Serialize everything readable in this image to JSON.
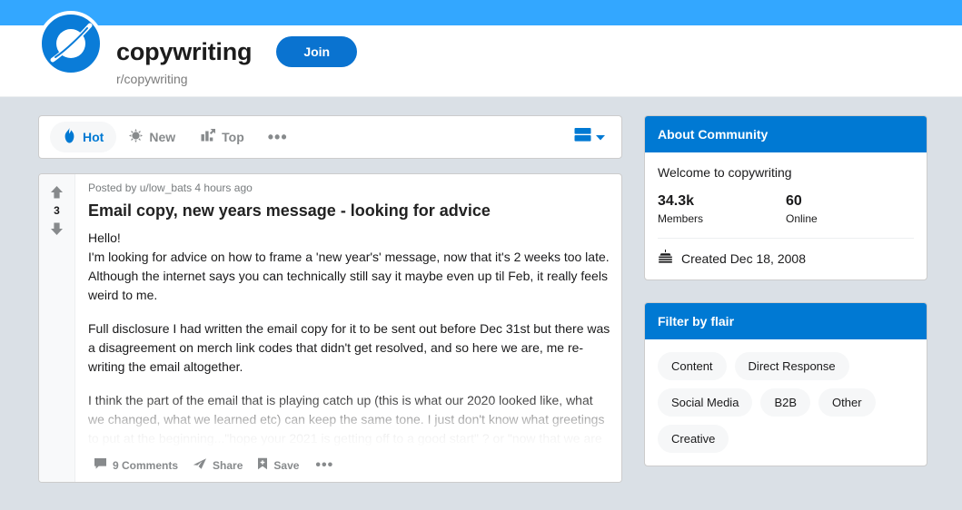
{
  "theme": {
    "banner_blue": "#33a7ff",
    "brand_blue": "#0079d3",
    "join_blue": "#0a73d0",
    "page_bg": "#dae0e6"
  },
  "header": {
    "sub_name": "copywriting",
    "sub_slug": "r/copywriting",
    "join_label": "Join",
    "icon_name": "subreddit-planet-icon"
  },
  "sortbar": {
    "tabs": [
      {
        "label": "Hot",
        "icon": "flame-icon",
        "active": true
      },
      {
        "label": "New",
        "icon": "starburst-icon",
        "active": false
      },
      {
        "label": "Top",
        "icon": "bar-chart-icon",
        "active": false
      }
    ],
    "overflow_label": "•••",
    "viewmode_icon": "card-view-icon",
    "viewmode_chevron": "chevron-down-icon"
  },
  "post": {
    "meta": "Posted by u/low_bats 4 hours ago",
    "title": "Email copy, new years message - looking for advice",
    "score": "3",
    "upvote_icon": "upvote-arrow-icon",
    "downvote_icon": "downvote-arrow-icon",
    "paragraphs": [
      "Hello!\nI'm looking for advice on how to frame a 'new year's' message, now that it's 2 weeks too late. Although the internet says you can technically still say it maybe even up til Feb, it really feels weird to me.",
      "Full disclosure I had written the email copy for it to be sent out before Dec 31st but there was a disagreement on merch link codes that didn't get resolved, and so here we are, me re-writing the email altogether.",
      "I think the part of the email that is playing catch up (this is what our 2020 looked like, what we changed, what we learned etc) can keep the same tone. I just don't know what greetings to put at the beginning...\"hope your 2021 is getting off to a good start\" ? or \"now that we are easing into a new year\" or \"we hope you enjoyed the holidays and are"
    ],
    "actions": {
      "comments_label": "9 Comments",
      "comments_icon": "comment-bubble-icon",
      "share_label": "Share",
      "share_icon": "share-arrow-icon",
      "save_label": "Save",
      "save_icon": "bookmark-icon",
      "overflow_label": "•••"
    }
  },
  "sidebar": {
    "about": {
      "title": "About Community",
      "welcome": "Welcome to copywriting",
      "members_count": "34.3k",
      "members_label": "Members",
      "online_count": "60",
      "online_label": "Online",
      "created": "Created Dec 18, 2008",
      "created_icon": "cake-icon"
    },
    "flair": {
      "title": "Filter by flair",
      "options": [
        "Content",
        "Direct Response",
        "Social Media",
        "B2B",
        "Other",
        "Creative"
      ]
    }
  }
}
